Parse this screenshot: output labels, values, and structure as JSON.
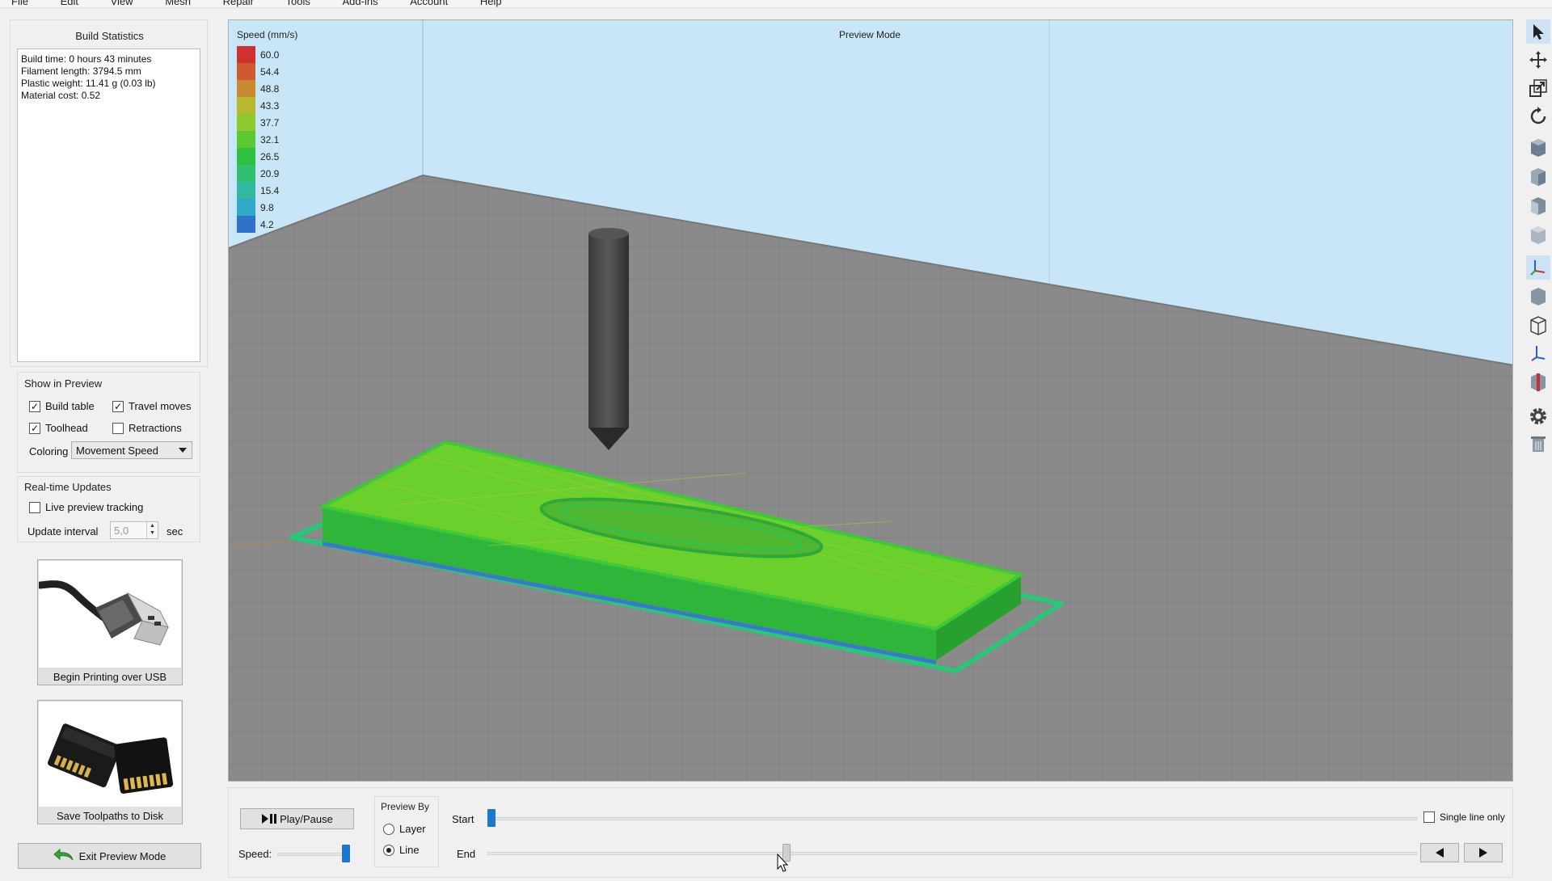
{
  "menu": [
    "File",
    "Edit",
    "View",
    "Mesh",
    "Repair",
    "Tools",
    "Add-ins",
    "Account",
    "Help"
  ],
  "build_statistics": {
    "title": "Build Statistics",
    "lines": [
      "Build time: 0 hours 43 minutes",
      "Filament length: 3794.5 mm",
      "Plastic weight: 11.41 g (0.03 lb)",
      "Material cost: 0.52"
    ]
  },
  "show_in_preview": {
    "title": "Show in Preview",
    "build_table": {
      "label": "Build table",
      "checked": true
    },
    "travel_moves": {
      "label": "Travel moves",
      "checked": true
    },
    "toolhead": {
      "label": "Toolhead",
      "checked": true
    },
    "retractions": {
      "label": "Retractions",
      "checked": false
    },
    "coloring_label": "Coloring",
    "coloring_value": "Movement Speed"
  },
  "realtime": {
    "title": "Real-time Updates",
    "live_tracking": {
      "label": "Live preview tracking",
      "checked": false
    },
    "interval_label": "Update interval",
    "interval_value": "5,0",
    "interval_unit": "sec"
  },
  "actions": {
    "usb_label": "Begin Printing over USB",
    "disk_label": "Save Toolpaths to Disk",
    "exit_label": "Exit Preview Mode"
  },
  "viewport": {
    "mode_label": "Preview Mode",
    "legend_title": "Speed (mm/s)",
    "legend": [
      {
        "value": "60.0",
        "color": "#d03030"
      },
      {
        "value": "54.4",
        "color": "#d05a30"
      },
      {
        "value": "48.8",
        "color": "#c88a30"
      },
      {
        "value": "43.3",
        "color": "#b8b830"
      },
      {
        "value": "37.7",
        "color": "#90c830"
      },
      {
        "value": "32.1",
        "color": "#5cc830"
      },
      {
        "value": "26.5",
        "color": "#30c040"
      },
      {
        "value": "20.9",
        "color": "#30c070"
      },
      {
        "value": "15.4",
        "color": "#30b8a0"
      },
      {
        "value": "9.8",
        "color": "#30a8c8"
      },
      {
        "value": "4.2",
        "color": "#2f70c8"
      }
    ]
  },
  "playback": {
    "play_label": "Play/Pause",
    "speed_label": "Speed:",
    "speed_level": 1.0,
    "preview_by_title": "Preview By",
    "layer_label": "Layer",
    "line_label": "Line",
    "selected": "Line",
    "start_label": "Start",
    "end_label": "End",
    "start_fraction": 0.0,
    "end_fraction": 0.32,
    "single_line_label": "Single line only",
    "single_line_checked": false
  },
  "toolbar_icons": [
    "select-icon",
    "move-icon",
    "scale-icon",
    "rotate-icon",
    "view-front-icon",
    "view-side-icon",
    "view-top-icon",
    "view-iso-icon",
    "axes-icon",
    "solid-view-icon",
    "wireframe-icon",
    "axis-toggle-icon",
    "section-icon",
    "settings-gear-icon",
    "trash-icon"
  ]
}
